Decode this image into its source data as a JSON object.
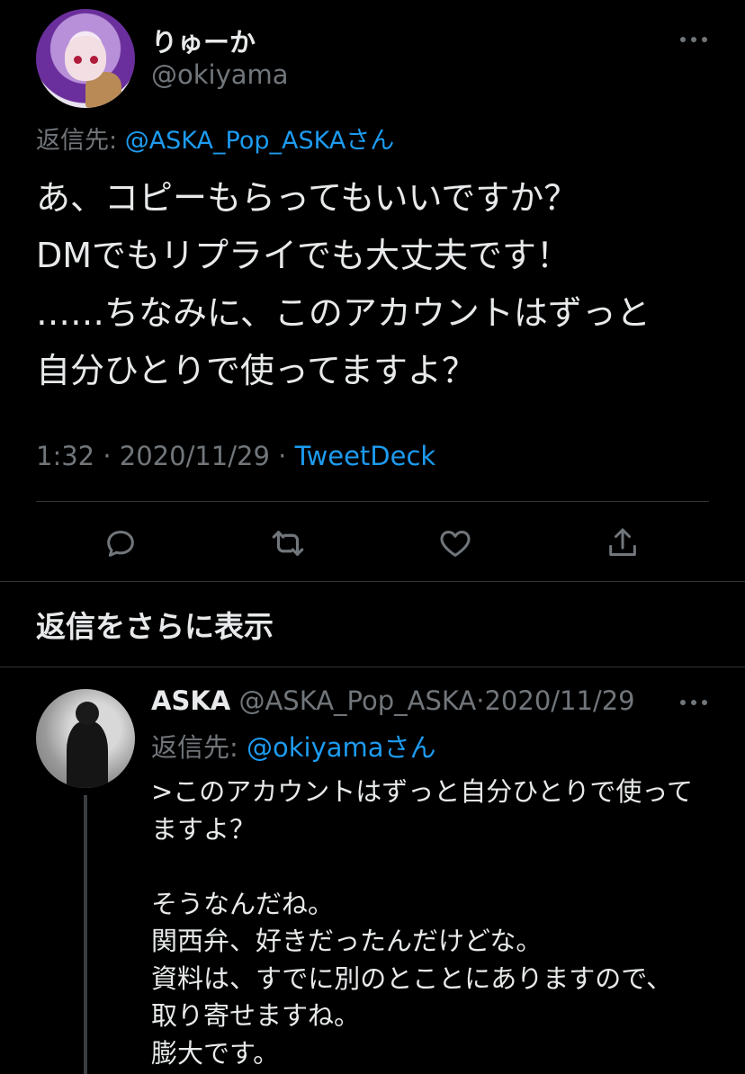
{
  "main_tweet": {
    "display_name": "りゅーか",
    "handle": "@okiyama",
    "reply_to_label": "返信先: ",
    "reply_to_user": "@ASKA_Pop_ASKAさん",
    "text_lines": [
      "あ、コピーもらってもいいですか？",
      "DMでもリプライでも大丈夫です！",
      "……ちなみに、このアカウントはずっと",
      "自分ひとりで使ってますよ？"
    ],
    "time": "1:32",
    "date": "2020/11/29",
    "source": "TweetDeck",
    "separator": " · "
  },
  "actions": {
    "reply_icon": "reply-bubble-icon",
    "retweet_icon": "retweet-icon",
    "like_icon": "heart-icon",
    "share_icon": "share-icon"
  },
  "show_more_replies": "返信をさらに表示",
  "reply_tweet": {
    "display_name": "ASKA",
    "handle": "@ASKA_Pop_ASKA",
    "date": "2020/11/29",
    "separator": "·",
    "reply_to_label": "返信先: ",
    "reply_to_user": "@okiyamaさん",
    "text_lines": [
      ">このアカウントはずっと自分ひとりで使って",
      "ますよ？",
      "",
      "そうなんだね。",
      "関西弁、好きだったんだけどな。",
      "資料は、すでに別のとことにありますので、",
      "取り寄せますね。",
      "膨大です。"
    ]
  },
  "colors": {
    "background": "#000000",
    "text": "#e7e9ea",
    "secondary": "#71767b",
    "accent": "#1d9bf0",
    "divider": "#2f3336"
  }
}
